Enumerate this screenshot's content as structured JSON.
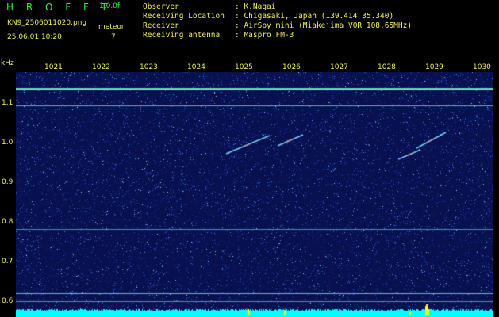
{
  "header": {
    "logo": "H R O F F T",
    "version": "1.0.0f",
    "filename": "KN9_2506011020.png",
    "kind": "meteor",
    "datetime": "25.06.01 10:20",
    "count": "7",
    "info": [
      {
        "label": "Observer",
        "value": ": K.Nagai"
      },
      {
        "label": "Receiving Location",
        "value": ": Chigasaki, Japan (139.414 35.340)"
      },
      {
        "label": "Receiver",
        "value": ": AirSpy mini (Miakejima VOR 108.65MHz)"
      },
      {
        "label": "Receiving antenna",
        "value": ": Maspro FM-3"
      }
    ]
  },
  "axes": {
    "y_unit": "kHz",
    "x_ticks": [
      "1021",
      "1022",
      "1023",
      "1024",
      "1025",
      "1026",
      "1027",
      "1028",
      "1029",
      "1030"
    ],
    "y_ticks": [
      "1.1",
      "1.0",
      "0.9",
      "0.8",
      "0.7",
      "0.6"
    ]
  },
  "colors": {
    "background": "#000000",
    "text_yellow": "#f2ec5a",
    "text_green": "#33ee33",
    "waterfall_base": "#08104e",
    "carrier_line": "#5fd6d6",
    "baseline": "#00ffff",
    "peak": "#ffff00"
  }
}
